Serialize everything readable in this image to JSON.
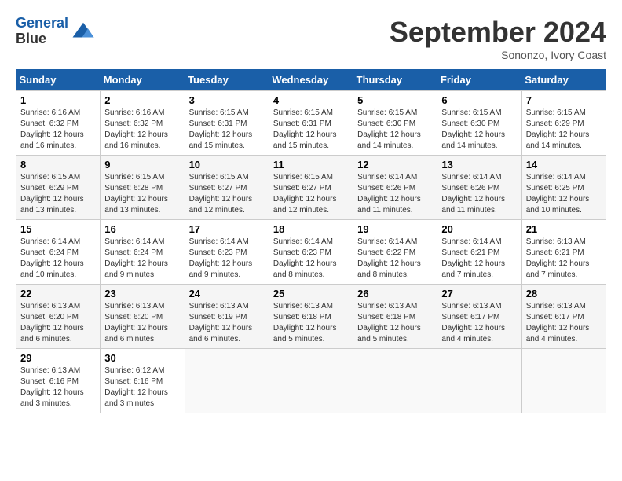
{
  "header": {
    "logo_line1": "General",
    "logo_line2": "Blue",
    "month_title": "September 2024",
    "location": "Sononzo, Ivory Coast"
  },
  "weekdays": [
    "Sunday",
    "Monday",
    "Tuesday",
    "Wednesday",
    "Thursday",
    "Friday",
    "Saturday"
  ],
  "weeks": [
    [
      {
        "day": "1",
        "sunrise": "6:16 AM",
        "sunset": "6:32 PM",
        "daylight": "12 hours and 16 minutes."
      },
      {
        "day": "2",
        "sunrise": "6:16 AM",
        "sunset": "6:32 PM",
        "daylight": "12 hours and 16 minutes."
      },
      {
        "day": "3",
        "sunrise": "6:15 AM",
        "sunset": "6:31 PM",
        "daylight": "12 hours and 15 minutes."
      },
      {
        "day": "4",
        "sunrise": "6:15 AM",
        "sunset": "6:31 PM",
        "daylight": "12 hours and 15 minutes."
      },
      {
        "day": "5",
        "sunrise": "6:15 AM",
        "sunset": "6:30 PM",
        "daylight": "12 hours and 14 minutes."
      },
      {
        "day": "6",
        "sunrise": "6:15 AM",
        "sunset": "6:30 PM",
        "daylight": "12 hours and 14 minutes."
      },
      {
        "day": "7",
        "sunrise": "6:15 AM",
        "sunset": "6:29 PM",
        "daylight": "12 hours and 14 minutes."
      }
    ],
    [
      {
        "day": "8",
        "sunrise": "6:15 AM",
        "sunset": "6:29 PM",
        "daylight": "12 hours and 13 minutes."
      },
      {
        "day": "9",
        "sunrise": "6:15 AM",
        "sunset": "6:28 PM",
        "daylight": "12 hours and 13 minutes."
      },
      {
        "day": "10",
        "sunrise": "6:15 AM",
        "sunset": "6:27 PM",
        "daylight": "12 hours and 12 minutes."
      },
      {
        "day": "11",
        "sunrise": "6:15 AM",
        "sunset": "6:27 PM",
        "daylight": "12 hours and 12 minutes."
      },
      {
        "day": "12",
        "sunrise": "6:14 AM",
        "sunset": "6:26 PM",
        "daylight": "12 hours and 11 minutes."
      },
      {
        "day": "13",
        "sunrise": "6:14 AM",
        "sunset": "6:26 PM",
        "daylight": "12 hours and 11 minutes."
      },
      {
        "day": "14",
        "sunrise": "6:14 AM",
        "sunset": "6:25 PM",
        "daylight": "12 hours and 10 minutes."
      }
    ],
    [
      {
        "day": "15",
        "sunrise": "6:14 AM",
        "sunset": "6:24 PM",
        "daylight": "12 hours and 10 minutes."
      },
      {
        "day": "16",
        "sunrise": "6:14 AM",
        "sunset": "6:24 PM",
        "daylight": "12 hours and 9 minutes."
      },
      {
        "day": "17",
        "sunrise": "6:14 AM",
        "sunset": "6:23 PM",
        "daylight": "12 hours and 9 minutes."
      },
      {
        "day": "18",
        "sunrise": "6:14 AM",
        "sunset": "6:23 PM",
        "daylight": "12 hours and 8 minutes."
      },
      {
        "day": "19",
        "sunrise": "6:14 AM",
        "sunset": "6:22 PM",
        "daylight": "12 hours and 8 minutes."
      },
      {
        "day": "20",
        "sunrise": "6:14 AM",
        "sunset": "6:21 PM",
        "daylight": "12 hours and 7 minutes."
      },
      {
        "day": "21",
        "sunrise": "6:13 AM",
        "sunset": "6:21 PM",
        "daylight": "12 hours and 7 minutes."
      }
    ],
    [
      {
        "day": "22",
        "sunrise": "6:13 AM",
        "sunset": "6:20 PM",
        "daylight": "12 hours and 6 minutes."
      },
      {
        "day": "23",
        "sunrise": "6:13 AM",
        "sunset": "6:20 PM",
        "daylight": "12 hours and 6 minutes."
      },
      {
        "day": "24",
        "sunrise": "6:13 AM",
        "sunset": "6:19 PM",
        "daylight": "12 hours and 6 minutes."
      },
      {
        "day": "25",
        "sunrise": "6:13 AM",
        "sunset": "6:18 PM",
        "daylight": "12 hours and 5 minutes."
      },
      {
        "day": "26",
        "sunrise": "6:13 AM",
        "sunset": "6:18 PM",
        "daylight": "12 hours and 5 minutes."
      },
      {
        "day": "27",
        "sunrise": "6:13 AM",
        "sunset": "6:17 PM",
        "daylight": "12 hours and 4 minutes."
      },
      {
        "day": "28",
        "sunrise": "6:13 AM",
        "sunset": "6:17 PM",
        "daylight": "12 hours and 4 minutes."
      }
    ],
    [
      {
        "day": "29",
        "sunrise": "6:13 AM",
        "sunset": "6:16 PM",
        "daylight": "12 hours and 3 minutes."
      },
      {
        "day": "30",
        "sunrise": "6:12 AM",
        "sunset": "6:16 PM",
        "daylight": "12 hours and 3 minutes."
      },
      null,
      null,
      null,
      null,
      null
    ]
  ]
}
